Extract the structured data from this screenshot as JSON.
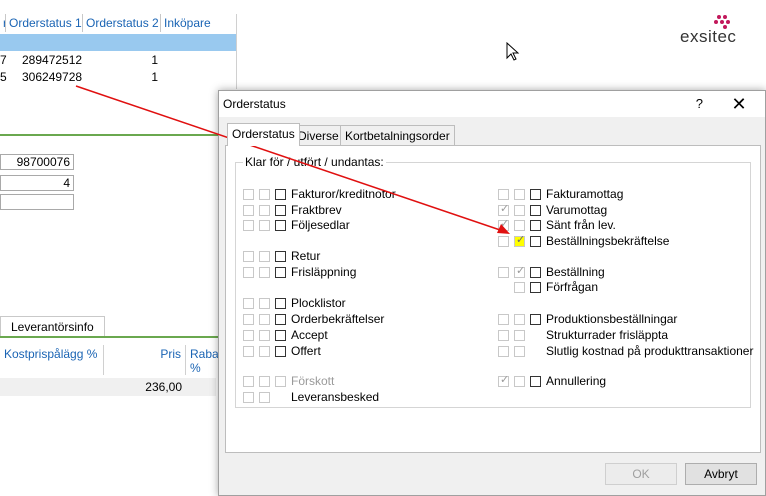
{
  "grid": {
    "headers": [
      "r",
      "Orderstatus 1",
      "Orderstatus 2",
      "Inköpare"
    ],
    "rows": [
      {
        "c0": "7",
        "c1": "289472512",
        "c2": "1"
      },
      {
        "c0": "5",
        "c1": "306249728",
        "c2": "1"
      }
    ]
  },
  "fields": {
    "f1": "98700076",
    "f2": "4",
    "f3": ""
  },
  "lower": {
    "tab_label": "Leverantörsinfo",
    "col_kostnad": "Kostprispålägg %",
    "col_pris": "Pris",
    "col_rabatt": "Rabat %",
    "row_value": "236,00"
  },
  "brand": {
    "logo_text": "exsitec",
    "dot_color": "#c2185b"
  },
  "arrow_color": "#e01010",
  "dialog": {
    "title": "Orderstatus",
    "help": "?",
    "close": "✕",
    "tabs": [
      "Orderstatus",
      "Diverse",
      "Kortbetalningsorder"
    ],
    "group_label": "Klar för / utfört / undantas:",
    "left_items": [
      {
        "label": "Fakturor/kreditnotor"
      },
      {
        "label": "Fraktbrev"
      },
      {
        "label": "Följesedlar"
      },
      {
        "label": "Retur"
      },
      {
        "label": "Frisläppning"
      },
      {
        "label": "Plocklistor"
      },
      {
        "label": "Orderbekräftelser"
      },
      {
        "label": "Accept"
      },
      {
        "label": "Offert"
      },
      {
        "label": "Förskott"
      },
      {
        "label": "Leveransbesked"
      }
    ],
    "right_items": [
      {
        "label": "Fakturamottag"
      },
      {
        "label": "Varumottag"
      },
      {
        "label": "Sänt från lev."
      },
      {
        "label": "Beställningsbekräftelse"
      },
      {
        "label": "Beställning"
      },
      {
        "label": "Förfrågan"
      },
      {
        "label": "Produktionsbeställningar"
      },
      {
        "label": "Strukturrader frisläppta"
      },
      {
        "label": "Slutlig kostnad på produkttransaktioner"
      },
      {
        "label": "Annullering"
      }
    ],
    "ok_label": "OK",
    "cancel_label": "Avbryt"
  }
}
